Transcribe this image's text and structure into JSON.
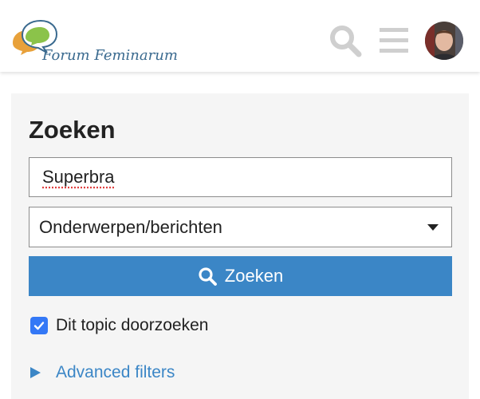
{
  "header": {
    "brand": "Forum Feminarum",
    "search_icon": "search-icon",
    "menu_icon": "hamburger-menu-icon",
    "avatar_icon": "user-avatar"
  },
  "search": {
    "title": "Zoeken",
    "query_value": "Superbra",
    "scope_selected": "Onderwerpen/berichten",
    "submit_label": "Zoeken",
    "checkbox_label": "Dit topic doorzoeken",
    "checkbox_checked": true,
    "advanced_label": "Advanced filters"
  },
  "colors": {
    "accent": "#3b86c6",
    "checkbox": "#3478f6",
    "panel_bg": "#f5f5f5",
    "icon_gray": "#cfcfcf"
  }
}
